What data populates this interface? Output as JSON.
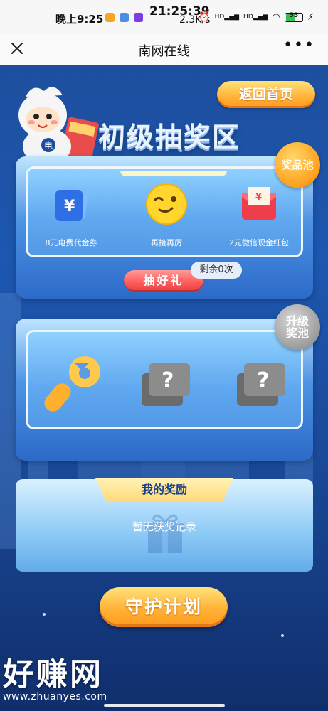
{
  "status_bar": {
    "time": "晚上9:25",
    "clock_overlay": "21:25:39",
    "network_speed": "2.3K/s",
    "battery": "55",
    "signal_labels": [
      "HD",
      "HD"
    ]
  },
  "nav": {
    "title": "南网在线",
    "close_icon": "close-icon",
    "more_icon": "more-icon"
  },
  "header": {
    "back_home_label": "返回首页",
    "area_title": "初级抽奖区"
  },
  "prize_pool": {
    "badge": "奖品池",
    "prizes": [
      {
        "label": "8元电费代金券",
        "icon": "voucher-icon"
      },
      {
        "label": "再接再厉",
        "icon": "wink-face-icon"
      },
      {
        "label": "2元微信现金红包",
        "icon": "red-envelope-icon"
      }
    ],
    "draw_button": "抽好礼",
    "remaining": "剩余0次"
  },
  "upgrade_pool": {
    "badge": "升级奖池",
    "items": [
      {
        "icon": "wrench-icon"
      },
      {
        "icon": "question-bubble-icon"
      },
      {
        "icon": "question-bubble-icon"
      }
    ]
  },
  "rewards": {
    "title": "我的奖励",
    "empty_text": "暂无获奖记录"
  },
  "guard_plan_label": "守护计划",
  "watermark": {
    "text": "好赚网",
    "url": "www.zhuanyes.com"
  },
  "colors": {
    "background": "#1d57b0",
    "button_orange": "#ffb236",
    "draw_red": "#ff5a5a"
  }
}
